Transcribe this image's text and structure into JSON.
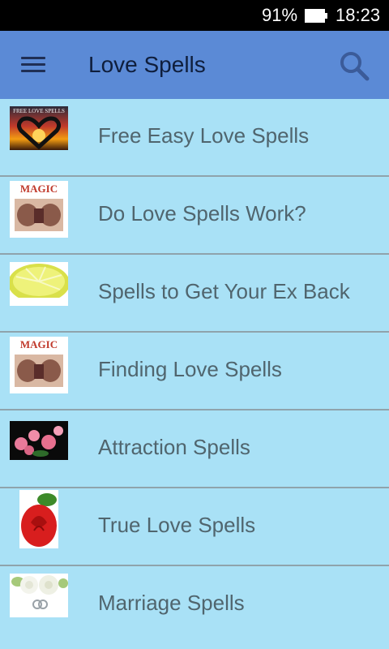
{
  "status_bar": {
    "battery_percent": "91%",
    "battery_icon": "battery-icon",
    "time": "18:23"
  },
  "app_bar": {
    "menu_icon": "hamburger-menu-icon",
    "title": "Love Spells",
    "search_icon": "search-icon"
  },
  "list": {
    "items": [
      {
        "label": "Free Easy Love Spells",
        "thumbnail": "heart-hands-sunset",
        "thumbnail_text": "FREE LOVE SPELLS"
      },
      {
        "label": "Do Love Spells Work?",
        "thumbnail": "magic-hands",
        "thumbnail_text": "MAGIC"
      },
      {
        "label": "Spells to Get Your Ex Back",
        "thumbnail": "lemon-slice"
      },
      {
        "label": "Finding Love Spells",
        "thumbnail": "magic-hands",
        "thumbnail_text": "MAGIC"
      },
      {
        "label": "Attraction Spells",
        "thumbnail": "pink-roses"
      },
      {
        "label": "True Love Spells",
        "thumbnail": "red-rose"
      },
      {
        "label": "Marriage Spells",
        "thumbnail": "white-roses-rings"
      }
    ]
  },
  "colors": {
    "status_bar": "#000000",
    "app_bar": "#5b8ad6",
    "list_background": "#a9e1f6",
    "item_text": "#50656e",
    "divider": "#8fa3ac"
  }
}
